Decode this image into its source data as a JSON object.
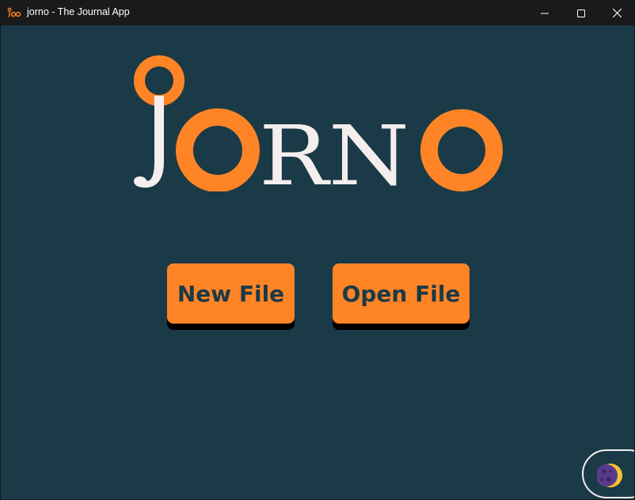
{
  "window": {
    "title": "jorno - The Journal App",
    "app_icon": "jorno-app-icon",
    "controls": [
      "minimize-icon",
      "maximize-icon",
      "close-icon"
    ]
  },
  "logo": {
    "text": "JORNO",
    "colors": {
      "letters": "#f4eeee",
      "circles": "#ff8426"
    }
  },
  "buttons": {
    "new_file": "New File",
    "open_file": "Open File"
  },
  "theme_toggle": {
    "icon": "moon-icon"
  },
  "colors": {
    "background": "#1b3a47",
    "accent": "#ff8426",
    "titlebar": "#1a1a1a",
    "text_light": "#f4eeee"
  }
}
